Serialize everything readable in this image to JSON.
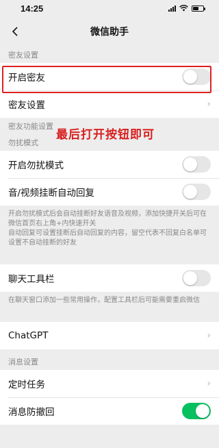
{
  "status": {
    "time": "14:25"
  },
  "nav": {
    "title": "微信助手"
  },
  "sections": {
    "friends_header": "密友设置",
    "friends_func_header": "密友功能设置",
    "dnd_header": "勿扰模式",
    "msg_header": "消息设置"
  },
  "rows": {
    "open_friends": "开启密友",
    "friends_settings": "密友设置",
    "open_dnd": "开启勿扰模式",
    "auto_reply": "音/视频挂断自动回复",
    "chat_toolbar": "聊天工具栏",
    "chatgpt": "ChatGPT",
    "scheduled_task": "定时任务",
    "anti_recall": "消息防撤回"
  },
  "toggles": {
    "open_friends": false,
    "open_dnd": false,
    "auto_reply": false,
    "chat_toolbar": false,
    "anti_recall": true
  },
  "descriptions": {
    "dnd": "开启勿扰模式后会自动挂断好友语音及视频，添加快捷开关后可在微信首页右上角+内快速开关\n自动回复可设置挂断后自动回复的内容，留空代表不回复白名单可设置不自动挂断的好友",
    "toolbar": "在聊天窗口添加一些常用操作，配置工具栏后可能需要重启微信"
  },
  "annotation": "最后打开按钮即可",
  "colors": {
    "accent_green": "#07c160",
    "highlight_red": "#e02020"
  }
}
